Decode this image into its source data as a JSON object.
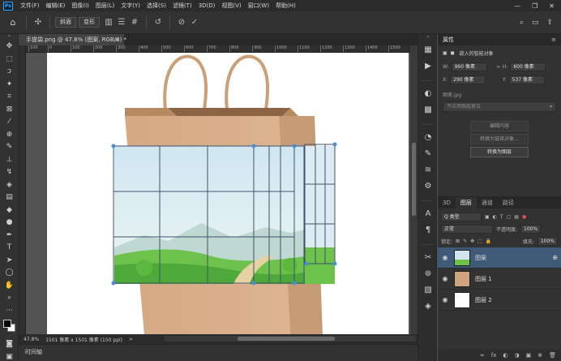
{
  "app": {
    "logo": "Ps",
    "menu": [
      "文件(F)",
      "编辑(E)",
      "图像(I)",
      "图层(L)",
      "文字(Y)",
      "选择(S)",
      "滤镜(T)",
      "3D(D)",
      "视图(V)",
      "窗口(W)",
      "帮助(H)"
    ],
    "window_controls": [
      "—",
      "❐",
      "✕"
    ]
  },
  "options": {
    "mode_buttons": [
      "斜面",
      "变形"
    ],
    "right_icons": [
      "search-icon",
      "workspace-icon",
      "share-icon"
    ]
  },
  "document": {
    "tab_title": "手提袋.png @ 47.8% (图案, RGB/8) *",
    "close": "×",
    "ruler_ticks": [
      "100",
      "0",
      "100",
      "200",
      "300",
      "400",
      "500",
      "600",
      "700",
      "800",
      "900",
      "1000",
      "1100",
      "1200",
      "1300",
      "1400",
      "1500"
    ],
    "zoom": "47.8%",
    "dimensions": "1501 像素 x 1501 像素 (150 ppi)",
    "status_arrow": ">"
  },
  "timeline": {
    "label": "时间轴"
  },
  "properties": {
    "title": "属性",
    "subtitle": "嵌入的智能对象",
    "w_label": "W:",
    "w_value": "960 像素",
    "h_label": "H:",
    "h_value": "600 像素",
    "x_label": "X:",
    "x_value": "290 像素",
    "y_label": "Y:",
    "y_value": "537 像素",
    "file_label": "图案.jpg",
    "comp_placeholder": "不应用图层复合",
    "btn_edit": "编辑内容",
    "btn_link": "转换为链接对象...",
    "btn_layer": "转换为图层"
  },
  "layers": {
    "tabs": [
      "3D",
      "图层",
      "通道",
      "路径"
    ],
    "active_tab": "图层",
    "filter_label": "Q 类型",
    "blend_mode": "正常",
    "opacity_label": "不透明度:",
    "opacity_value": "100%",
    "lock_label": "锁定:",
    "fill_label": "填充:",
    "fill_value": "100%",
    "items": [
      {
        "name": "图案",
        "selected": true
      },
      {
        "name": "图层 1",
        "selected": false
      },
      {
        "name": "图层 2",
        "selected": false
      }
    ],
    "footer_icons": [
      "∞",
      "fx",
      "◐",
      "◑",
      "▣",
      "⊕",
      "🗑"
    ]
  },
  "colors": {
    "selection": "#3f5a78",
    "accent": "#31a8ff",
    "bag": "#d9b08a",
    "sky_top": "#cfe6f1",
    "grass": "#6cc24a"
  }
}
